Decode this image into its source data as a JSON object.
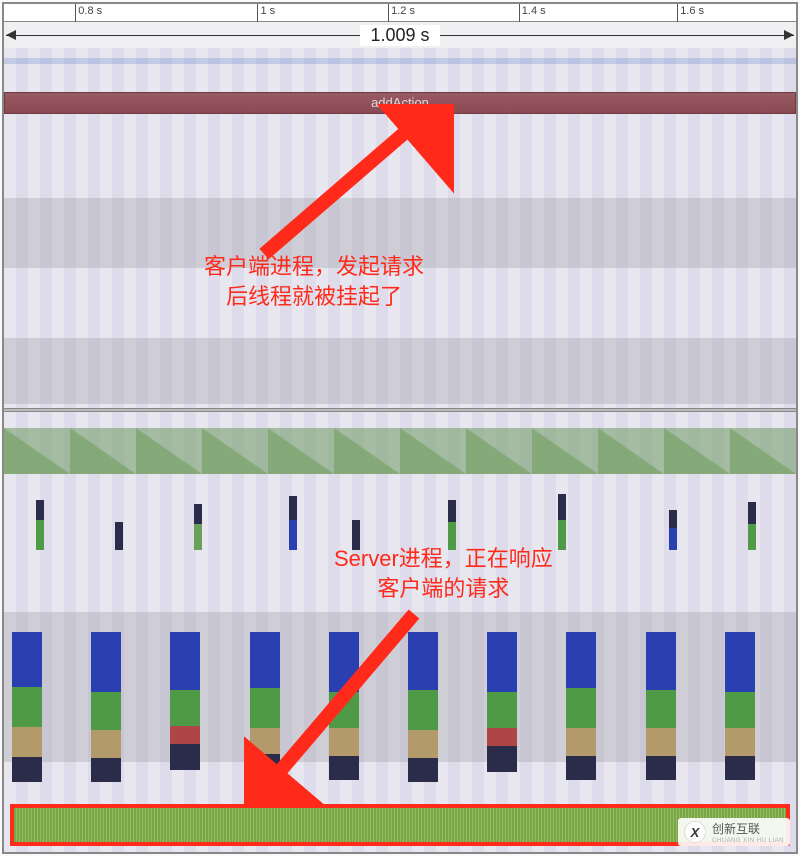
{
  "ruler": {
    "ticks": [
      "0.8 s",
      "1 s",
      "1.2 s",
      "1.4 s",
      "1.6 s"
    ],
    "tick_positions_pct": [
      9,
      32,
      48.5,
      65,
      85
    ]
  },
  "total_span_label": "1.009 s",
  "trace": {
    "call_bar_label": "addAction"
  },
  "annotations": {
    "client": {
      "line1": "客户端进程，发起请求",
      "line2": "后线程就被挂起了"
    },
    "server": {
      "line1": "Server进程，正在响应",
      "line2": "客户端的请求"
    }
  },
  "watermark": {
    "logo_letter": "X",
    "name": "创新互联",
    "tagline": "CHUANG XIN HU LIAN"
  },
  "chart_data": {
    "type": "timeline",
    "x_unit": "s",
    "visible_range_s": [
      0.7,
      1.71
    ],
    "total_span_s": 1.009,
    "panes": [
      {
        "name": "client-process",
        "annotation": "客户端进程，发起请求后线程就被挂起了",
        "events": [
          {
            "label": "addAction",
            "start_s": 0.7,
            "end_s": 1.71,
            "type": "blocked-call"
          }
        ]
      },
      {
        "name": "server-process",
        "annotation": "Server进程，正在响应客户端的请求",
        "cpu_ramp_period_s": 0.08,
        "activity": {
          "start_s": 0.7,
          "end_s": 1.71,
          "description": "continuous request handling (highlighted)"
        },
        "burst_centers_s": [
          0.73,
          0.84,
          0.92,
          1.0,
          1.09,
          1.18,
          1.26,
          1.36,
          1.44,
          1.53,
          1.6,
          1.69
        ]
      }
    ]
  }
}
